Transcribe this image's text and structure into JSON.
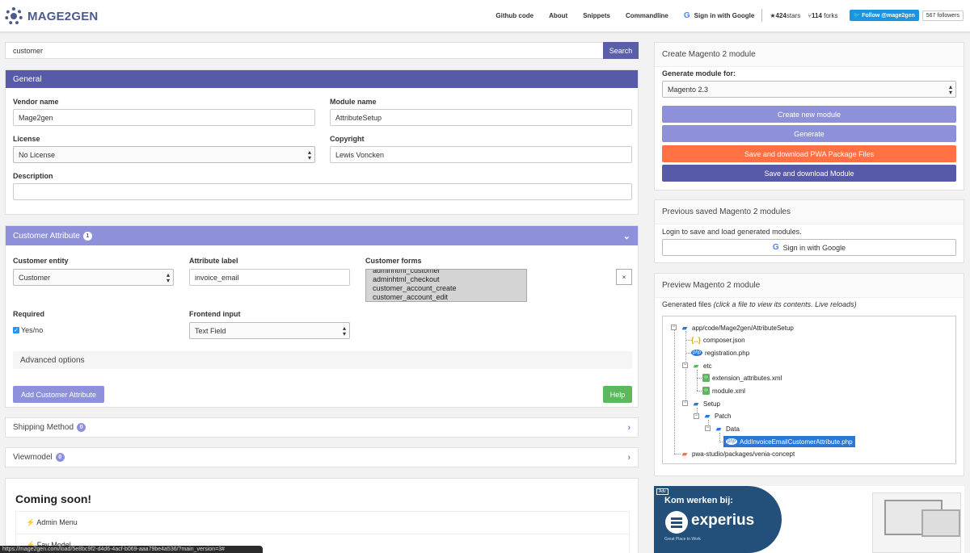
{
  "nav": {
    "brand": "MAGE2GEN",
    "links": [
      "Github code",
      "About",
      "Snippets",
      "Commandline"
    ],
    "google_signin": "Sign in with Google",
    "stars_count": "424",
    "stars_label": "stars",
    "forks_count": "114",
    "forks_label": "forks",
    "twitter_follow": "Follow @mage2gen",
    "followers": "567 followers"
  },
  "search": {
    "value": "customer",
    "button": "Search"
  },
  "general": {
    "title": "General",
    "vendor_label": "Vendor name",
    "vendor_value": "Mage2gen",
    "module_label": "Module name",
    "module_value": "AttributeSetup",
    "license_label": "License",
    "license_value": "No License",
    "copyright_label": "Copyright",
    "copyright_value": "Lewis Voncken",
    "description_label": "Description",
    "description_value": ""
  },
  "customer_attribute": {
    "title": "Customer Attribute",
    "badge": "1",
    "entity_label": "Customer entity",
    "entity_value": "Customer",
    "attr_label_label": "Attribute label",
    "attr_label_value": "invoice_email",
    "forms_label": "Customer forms",
    "forms": [
      "adminhtml_customer",
      "adminhtml_checkout",
      "customer_account_create",
      "customer_account_edit"
    ],
    "clear": "×",
    "required_label": "Required",
    "required_option": "Yes/no",
    "frontend_label": "Frontend input",
    "frontend_value": "Text Field",
    "advanced": "Advanced options",
    "add_button": "Add Customer Attribute",
    "help_button": "Help"
  },
  "shipping": {
    "title": "Shipping Method",
    "badge": "0"
  },
  "viewmodel": {
    "title": "Viewmodel",
    "badge": "0"
  },
  "coming_soon": {
    "title": "Coming soon!",
    "items": [
      "Admin Menu",
      "Fav Model"
    ]
  },
  "create_module": {
    "title": "Create Magento 2 module",
    "generate_for_label": "Generate module for:",
    "version": "Magento 2.3",
    "buttons": {
      "create_new": "Create new module",
      "generate": "Generate",
      "save_pwa": "Save and download PWA Package Files",
      "save_module": "Save and download Module"
    },
    "colors": {
      "light": "#8e91da",
      "orange": "#ff7043",
      "dark": "#575aa8"
    }
  },
  "previous": {
    "title": "Previous saved Magento 2 modules",
    "login_text": "Login to save and load generated modules.",
    "google_signin": "Sign in with Google"
  },
  "preview": {
    "title": "Preview Magento 2 module",
    "generated_label": "Generated files",
    "generated_hint": "(click a file to view its contents. Live reloads)",
    "tree": {
      "root": "app/code/Mage2gen/AttributeSetup",
      "composer": "composer.json",
      "registration": "registration.php",
      "etc": "etc",
      "ext_attr": "extension_attributes.xml",
      "module_xml": "module.xml",
      "setup": "Setup",
      "patch": "Patch",
      "data": "Data",
      "patch_file": "AddInvoiceEmailCustomerAttribute.php",
      "pwa": "pwa-studio/packages/venia-concept"
    }
  },
  "ad": {
    "label": "Adv",
    "title": "Kom werken bij:",
    "brand": "experius",
    "tagline": "Great Place to Work"
  },
  "status_url": "https://mage2gen.com/load/5e8bc9f2-d4d6-4acf-b069-aaa79be4a536/?main_version=3#"
}
